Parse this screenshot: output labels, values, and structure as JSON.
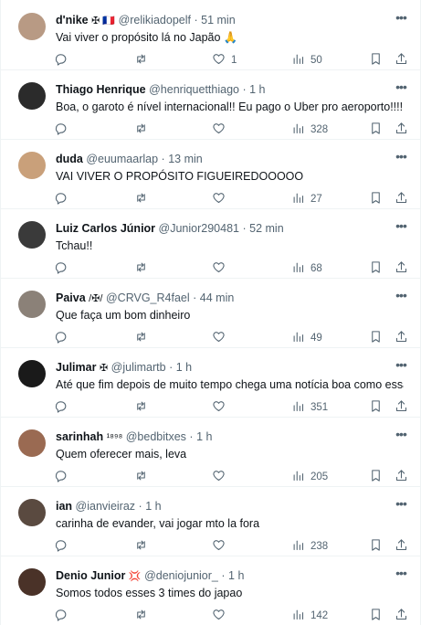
{
  "replies": [
    {
      "name": "d'nike",
      "badges": "✠ 🇫🇷",
      "handle": "@relikiadopelf",
      "sep": "·",
      "time": "51 min",
      "text": "Vai viver o propósito lá no Japão 🙏",
      "replies_count": "",
      "reposts": "",
      "likes": "1",
      "views": "50",
      "avatar_color": "#b89a84"
    },
    {
      "name": "Thiago Henrique",
      "badges": "",
      "handle": "@henriquetthiago",
      "sep": "·",
      "time": "1 h",
      "text": "Boa, o garoto é nível internacional!! Eu pago o Uber pro aeroporto!!!!",
      "replies_count": "",
      "reposts": "",
      "likes": "",
      "views": "328",
      "avatar_color": "#2b2b2b"
    },
    {
      "name": "duda",
      "badges": "",
      "handle": "@euumaarlap",
      "sep": "·",
      "time": "13 min",
      "text": "VAI VIVER O PROPÓSITO FIGUEIREDOOOOO",
      "replies_count": "",
      "reposts": "",
      "likes": "",
      "views": "27",
      "avatar_color": "#c9a07a"
    },
    {
      "name": "Luiz Carlos Júnior",
      "badges": "",
      "handle": "@Junior290481",
      "sep": "·",
      "time": "52 min",
      "text": "Tchau!!",
      "replies_count": "",
      "reposts": "",
      "likes": "",
      "views": "68",
      "avatar_color": "#3a3a3a"
    },
    {
      "name": "Paiva",
      "badges": "/✠/",
      "handle": "@CRVG_R4fael",
      "sep": "·",
      "time": "44 min",
      "text": "Que faça um bom dinheiro",
      "replies_count": "",
      "reposts": "",
      "likes": "",
      "views": "49",
      "avatar_color": "#8b8178"
    },
    {
      "name": "Julimar",
      "badges": "✠",
      "handle": "@julimartb",
      "sep": "·",
      "time": "1 h",
      "text": "Até que fim depois de muito tempo chega uma notícia boa como essa. 🤑",
      "replies_count": "",
      "reposts": "",
      "likes": "",
      "views": "351",
      "avatar_color": "#1a1a1a"
    },
    {
      "name": "sarinhah",
      "badges": "¹⁸⁹⁸",
      "handle": "@bedbitxes",
      "sep": "·",
      "time": "1 h",
      "text": "Quem oferecer mais, leva",
      "replies_count": "",
      "reposts": "",
      "likes": "",
      "views": "205",
      "avatar_color": "#9a6a52"
    },
    {
      "name": "ian",
      "badges": "",
      "handle": "@ianvieiraz",
      "sep": "·",
      "time": "1 h",
      "text": "carinha de evander, vai jogar mto la fora",
      "replies_count": "",
      "reposts": "",
      "likes": "",
      "views": "238",
      "avatar_color": "#5a4a40"
    },
    {
      "name": "Denio Junior",
      "badges": "💢",
      "handle": "@deniojunior_",
      "sep": "·",
      "time": "1 h",
      "text": "Somos todos esses 3 times do japao",
      "replies_count": "",
      "reposts": "",
      "likes": "",
      "views": "142",
      "avatar_color": "#4a3228"
    }
  ],
  "icons": {
    "more": "more-icon",
    "reply": "reply-icon",
    "repost": "repost-icon",
    "like": "heart-icon",
    "views": "views-icon",
    "bookmark": "bookmark-icon",
    "share": "share-icon"
  },
  "colors": {
    "text": "#0f1419",
    "muted": "#536471",
    "divider": "#eff3f4"
  }
}
